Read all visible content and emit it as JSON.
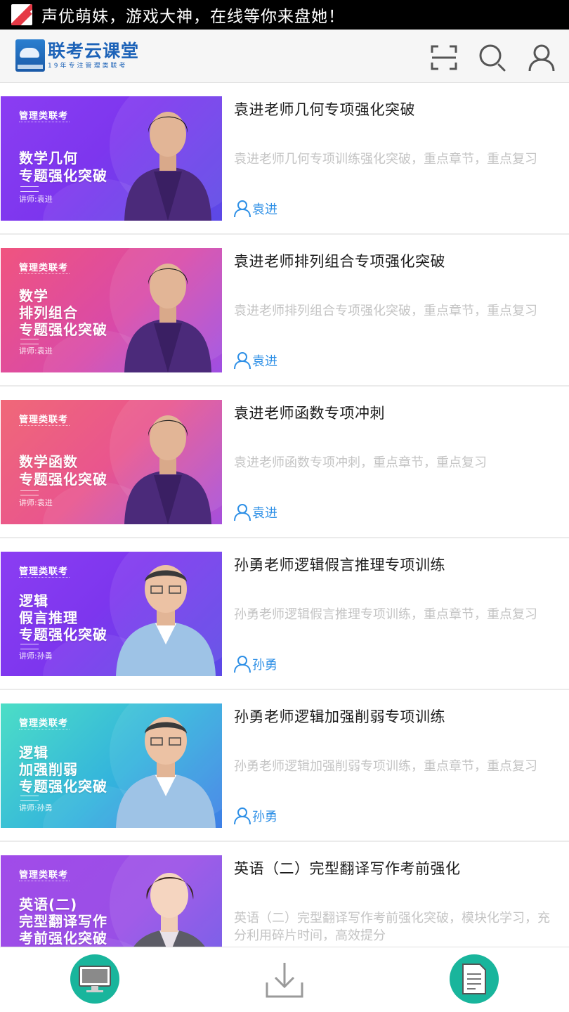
{
  "ad_bar": {
    "text": "声优萌妹，游戏大神，在线等你来盘她！",
    "icon": "ad-app-icon"
  },
  "header": {
    "brand_name": "联考云课堂",
    "brand_slogan": "19年专注管理类联考",
    "icons": [
      "scan-icon",
      "search-icon",
      "user-icon"
    ]
  },
  "courses": [
    {
      "title": "袁进老师几何专项强化突破",
      "description": "袁进老师几何专项训练强化突破，重点章节，重点复习",
      "teacher": "袁进",
      "thumb": {
        "tag": "管理类联考",
        "lines": [
          "数学几何",
          "专题强化突破"
        ],
        "lecturer": "讲师:袁进",
        "theme": "purple"
      }
    },
    {
      "title": "袁进老师排列组合专项强化突破",
      "description": "袁进老师排列组合专项强化突破，重点章节，重点复习",
      "teacher": "袁进",
      "thumb": {
        "tag": "管理类联考",
        "lines": [
          "数学",
          "排列组合",
          "专题强化突破"
        ],
        "lecturer": "讲师:袁进",
        "theme": "pink"
      }
    },
    {
      "title": "袁进老师函数专项冲刺",
      "description": "袁进老师函数专项冲刺，重点章节，重点复习",
      "teacher": "袁进",
      "thumb": {
        "tag": "管理类联考",
        "lines": [
          "数学函数",
          "专题强化突破"
        ],
        "lecturer": "讲师:袁进",
        "theme": "coral"
      }
    },
    {
      "title": "孙勇老师逻辑假言推理专项训练",
      "description": "孙勇老师逻辑假言推理专项训练，重点章节，重点复习",
      "teacher": "孙勇",
      "thumb": {
        "tag": "管理类联考",
        "lines": [
          "逻辑",
          "假言推理",
          "专题强化突破"
        ],
        "lecturer": "讲师:孙勇",
        "theme": "purple"
      }
    },
    {
      "title": "孙勇老师逻辑加强削弱专项训练",
      "description": "孙勇老师逻辑加强削弱专项训练，重点章节，重点复习",
      "teacher": "孙勇",
      "thumb": {
        "tag": "管理类联考",
        "lines": [
          "逻辑",
          "加强削弱",
          "专题强化突破"
        ],
        "lecturer": "讲师:孙勇",
        "theme": "teal"
      }
    },
    {
      "title": "英语（二）完型翻译写作考前强化",
      "description": "英语（二）完型翻译写作考前强化突破，模块化学习，充分利用碎片时间，高效提分",
      "teacher": "",
      "thumb": {
        "tag": "管理类联考",
        "lines": [
          "英语(二)",
          "完型翻译写作",
          "考前强化突破"
        ],
        "lecturer": "",
        "theme": "violet"
      }
    }
  ],
  "bottom_nav": [
    {
      "icon": "computer-icon",
      "active": true
    },
    {
      "icon": "download-icon",
      "active": false
    },
    {
      "icon": "notes-icon",
      "active": true
    }
  ],
  "colors": {
    "accent": "#2d8fe6",
    "brand": "#1d63b8",
    "nav_active": "#19b59c"
  }
}
